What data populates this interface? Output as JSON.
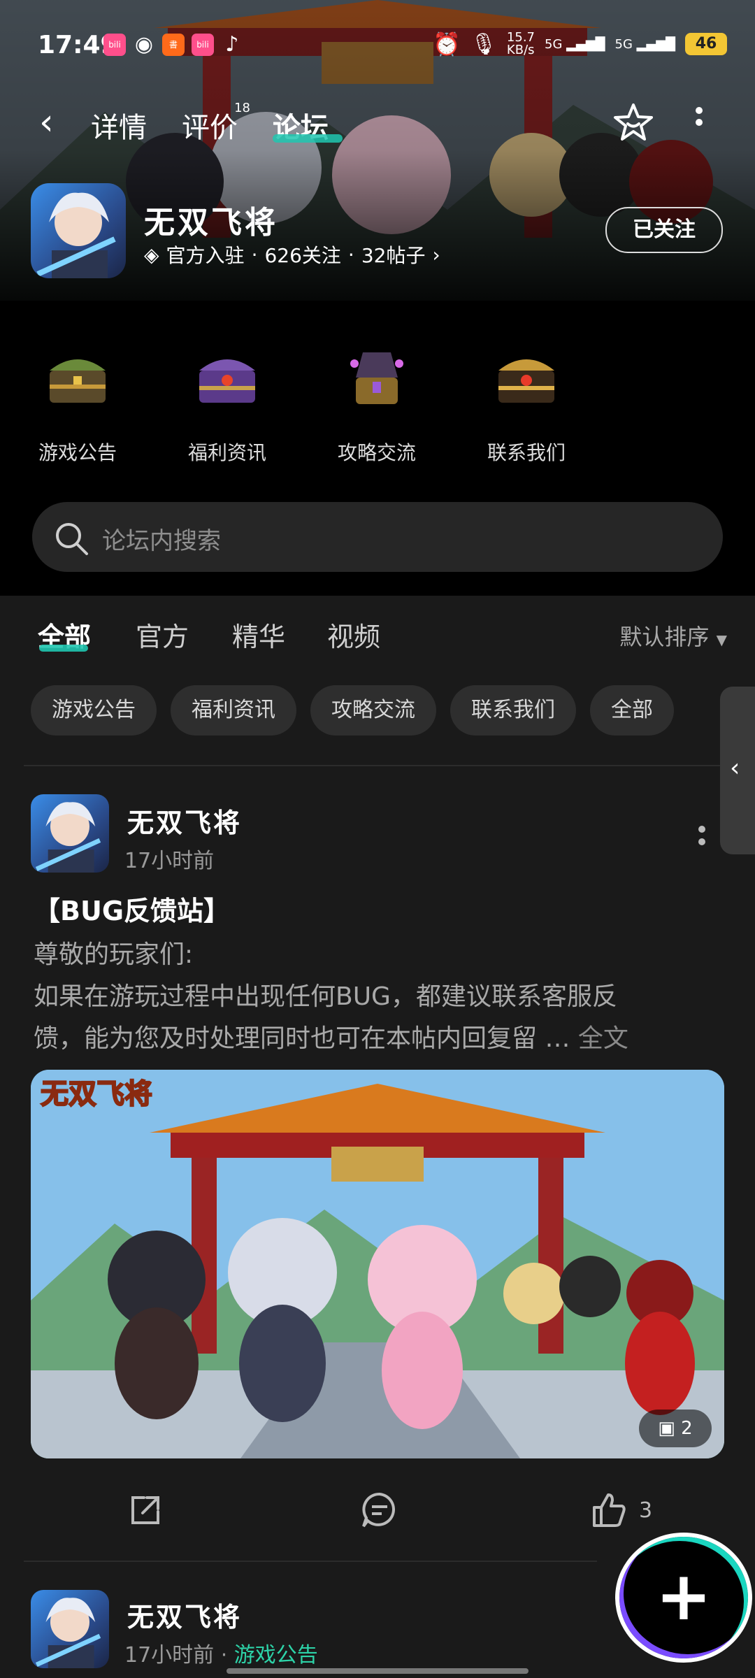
{
  "status_bar": {
    "time": "17:49",
    "apps": [
      "bilibili",
      "wechat",
      "xiaohongshu",
      "bilibili",
      "tiktok"
    ],
    "net_speed": "15.7",
    "net_unit": "KB/s",
    "net1": "5G",
    "net2": "5G",
    "battery": "46"
  },
  "nav": {
    "tabs": [
      {
        "label": "详情"
      },
      {
        "label": "评价",
        "sup": "18"
      },
      {
        "label": "论坛"
      }
    ]
  },
  "app": {
    "name": "无双飞将",
    "meta": {
      "official": "官方入驻",
      "follows": "626关注",
      "posts": "32帖子"
    },
    "follow_button": "已关注"
  },
  "categories": [
    {
      "label": "游戏公告",
      "icon": "green-treasure-chest-icon"
    },
    {
      "label": "福利资讯",
      "icon": "purple-treasure-chest-icon"
    },
    {
      "label": "攻略交流",
      "icon": "open-chest-icon"
    },
    {
      "label": "联系我们",
      "icon": "gold-treasure-chest-icon"
    }
  ],
  "search": {
    "placeholder": "论坛内搜索"
  },
  "feed_tabs": [
    "全部",
    "官方",
    "精华",
    "视频"
  ],
  "sort": "默认排序",
  "chips": [
    "游戏公告",
    "福利资讯",
    "攻略交流",
    "联系我们",
    "全部"
  ],
  "posts": [
    {
      "author": "无双飞将",
      "time": "17小时前",
      "title": "【BUG反馈站】",
      "body_line1": "尊敬的玩家们:",
      "body_line2": " 如果在游玩过程中出现任何BUG，都建议联系客服反",
      "body_line3": "馈，能为您及时处理同时也可在本帖内回复留 …",
      "read_more": "全文",
      "image_logo": "无双飞将",
      "image_count": "2",
      "likes": "3"
    },
    {
      "author": "无双飞将",
      "time": "17小时前",
      "category": "游戏公告"
    }
  ],
  "colors": {
    "accent": "#20c7b0",
    "category_tag": "#2dd3a8",
    "background": "#1a1a1a",
    "chip_bg": "#2e2e2e"
  }
}
